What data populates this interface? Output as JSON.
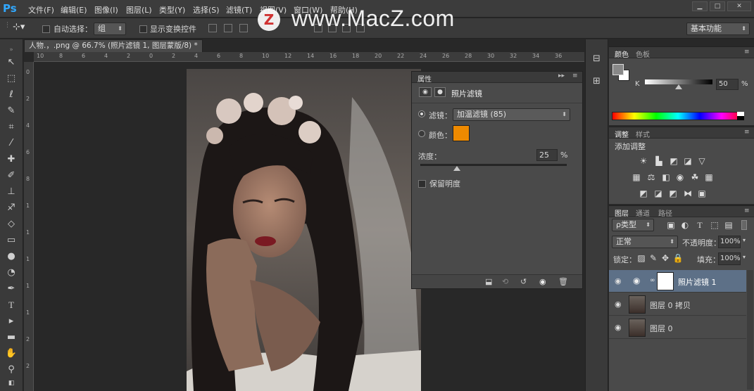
{
  "menubar": {
    "logo": "Ps",
    "items": [
      "文件(F)",
      "编辑(E)",
      "图像(I)",
      "图层(L)",
      "类型(Y)",
      "选择(S)",
      "滤镜(T)",
      "视图(V)",
      "窗口(W)",
      "帮助(H)"
    ]
  },
  "watermark": {
    "icon_letter": "Z",
    "text": "www.MacZ.com"
  },
  "options": {
    "auto_select_label": "自动选择：",
    "auto_select_value": "组",
    "show_transform_label": "显示变换控件",
    "workspace_value": "基本功能"
  },
  "document": {
    "tab_title": "人物.，.png @ 66.7% (照片滤镜 1, 图层蒙版/8) *",
    "ruler_top_ticks": [
      "10",
      "8",
      "6",
      "4",
      "2",
      "0",
      "2",
      "4",
      "6",
      "8",
      "10",
      "12",
      "14",
      "16",
      "18",
      "20",
      "22",
      "24",
      "26",
      "28",
      "30",
      "32",
      "34",
      "36"
    ],
    "ruler_left_ticks": [
      "0",
      "2",
      "4",
      "6",
      "8",
      "1",
      "1",
      "1",
      "1",
      "1",
      "2",
      "2"
    ]
  },
  "properties": {
    "title": "属性",
    "panel_name": "照片滤镜",
    "filter_label": "滤镜：",
    "filter_value": "加温滤镜 (85)",
    "color_label": "颜色：",
    "color_swatch": "#ee8a00",
    "density_label": "浓度：",
    "density_value": "25",
    "density_unit": "%",
    "density_percent": 25,
    "preserve_label": "保留明度"
  },
  "color_panel": {
    "tabs": [
      "颜色",
      "色板"
    ],
    "k_label": "K",
    "k_value": "50",
    "k_unit": "%",
    "k_percent": 50
  },
  "adjust_panel": {
    "tabs": [
      "调整",
      "样式"
    ],
    "add_label": "添加调整"
  },
  "layers_panel": {
    "tabs": [
      "图层",
      "通道",
      "路径"
    ],
    "kind_label": "ρ类型",
    "blend_mode": "正常",
    "opacity_label": "不透明度：",
    "opacity_value": "100%",
    "lock_label": "锁定：",
    "fill_label": "填充：",
    "fill_value": "100%",
    "layers": [
      {
        "name": "照片滤镜 1",
        "selected": true
      },
      {
        "name": "图层 0 拷贝",
        "selected": false
      },
      {
        "name": "图层 0",
        "selected": false
      }
    ]
  }
}
